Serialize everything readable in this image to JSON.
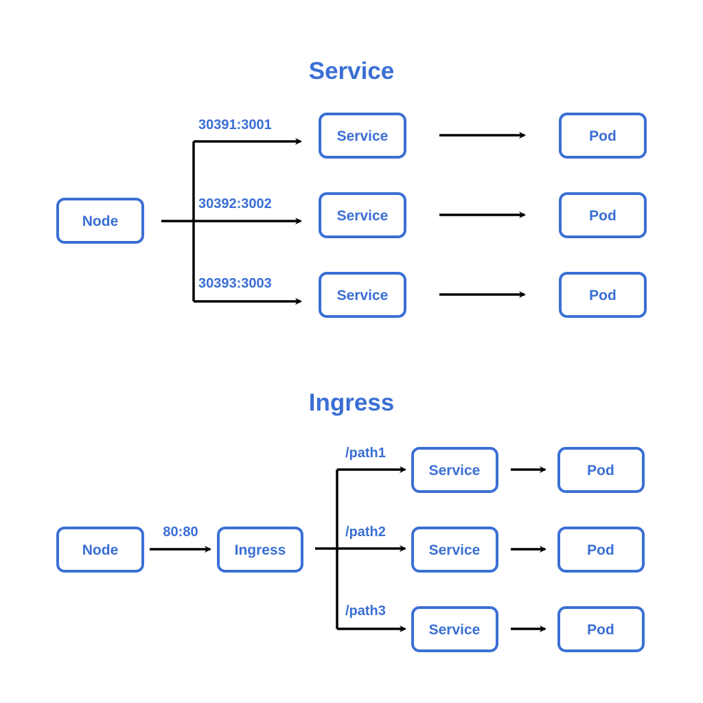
{
  "colors": {
    "accent": "#3a6fd4",
    "arrow": "#000000",
    "background": "#ffffff"
  },
  "service_section": {
    "title": "Service",
    "node_label": "Node",
    "routes": [
      {
        "port_label": "30391:3001",
        "service_label": "Service",
        "pod_label": "Pod"
      },
      {
        "port_label": "30392:3002",
        "service_label": "Service",
        "pod_label": "Pod"
      },
      {
        "port_label": "30393:3003",
        "service_label": "Service",
        "pod_label": "Pod"
      }
    ]
  },
  "ingress_section": {
    "title": "Ingress",
    "node_label": "Node",
    "node_to_ingress_label": "80:80",
    "ingress_label": "Ingress",
    "routes": [
      {
        "path_label": "/path1",
        "service_label": "Service",
        "pod_label": "Pod"
      },
      {
        "path_label": "/path2",
        "service_label": "Service",
        "pod_label": "Pod"
      },
      {
        "path_label": "/path3",
        "service_label": "Service",
        "pod_label": "Pod"
      }
    ]
  }
}
